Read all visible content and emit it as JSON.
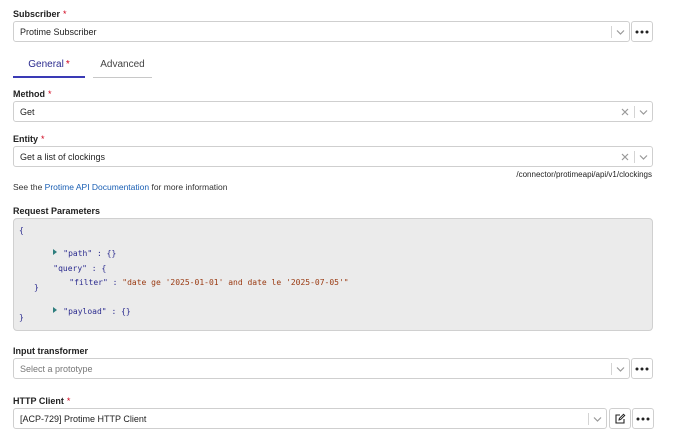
{
  "subscriber": {
    "label": "Subscriber",
    "required_mark": "*",
    "value": "Protime Subscriber"
  },
  "tabs": [
    {
      "label": "General",
      "required_mark": "*",
      "active": true
    },
    {
      "label": "Advanced",
      "active": false
    }
  ],
  "method": {
    "label": "Method",
    "required_mark": "*",
    "value": "Get"
  },
  "entity": {
    "label": "Entity",
    "required_mark": "*",
    "value": "Get a list of clockings",
    "path_hint": "/connector/protimeapi/api/v1/clockings"
  },
  "info": {
    "prefix": "See the ",
    "link_text": "Protime API Documentation",
    "suffix": " for more information"
  },
  "request_parameters": {
    "label": "Request Parameters",
    "json": {
      "open_brace": "{",
      "path_key": "\"path\"",
      "path_sep": " : ",
      "path_value": "{}",
      "query_key": "\"query\"",
      "query_sep": " : ",
      "query_open": "{",
      "filter_key": "\"filter\"",
      "filter_sep": " : ",
      "filter_value": "\"date ge '2025-01-01' and date le '2025-07-05'\"",
      "query_close": "}",
      "payload_key": "\"payload\"",
      "payload_sep": " : ",
      "payload_value": "{}",
      "close_brace": "}"
    }
  },
  "input_transformer": {
    "label": "Input transformer",
    "placeholder": "Select a prototype"
  },
  "http_client": {
    "label": "HTTP Client",
    "required_mark": "*",
    "value": "[ACP-729] Protime HTTP Client"
  },
  "icons": {
    "more": "more-horizontal-icon",
    "chevron": "chevron-down-icon",
    "clear": "close-icon",
    "edit": "edit-icon",
    "expand": "expand-triangle-icon"
  },
  "colors": {
    "accent": "#3a3ab5",
    "required": "#d0021b",
    "link": "#1a5fb4",
    "code_bg": "#ebebeb"
  }
}
